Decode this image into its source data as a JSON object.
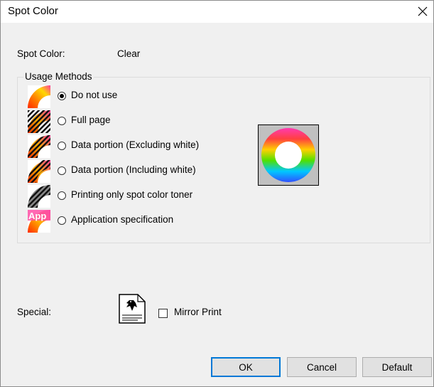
{
  "window": {
    "title": "Spot Color"
  },
  "spot_color": {
    "label": "Spot Color:",
    "value": "Clear"
  },
  "usage_methods": {
    "legend": "Usage Methods",
    "options": [
      {
        "label": "Do not use",
        "checked": true,
        "icon": "rainbow-arc-icon"
      },
      {
        "label": "Full page",
        "checked": false,
        "icon": "full-page-hatch-icon"
      },
      {
        "label": "Data portion (Excluding white)",
        "checked": false,
        "icon": "data-excluding-white-icon"
      },
      {
        "label": "Data portion (Including white)",
        "checked": false,
        "icon": "data-including-white-icon"
      },
      {
        "label": "Printing only spot color toner",
        "checked": false,
        "icon": "spot-toner-only-icon"
      },
      {
        "label": "Application specification",
        "checked": false,
        "icon": "app-spec-icon",
        "icon_text": "App"
      }
    ],
    "preview_icon": "color-wheel-icon"
  },
  "special": {
    "label": "Special:",
    "icon": "mirror-print-document-icon",
    "mirror_print_label": "Mirror Print",
    "mirror_print_checked": false
  },
  "buttons": {
    "ok": "OK",
    "cancel": "Cancel",
    "default": "Default"
  },
  "colors": {
    "dialog_bg": "#f0f0f0",
    "focus_border": "#0078d7",
    "button_bg": "#e1e1e1"
  }
}
